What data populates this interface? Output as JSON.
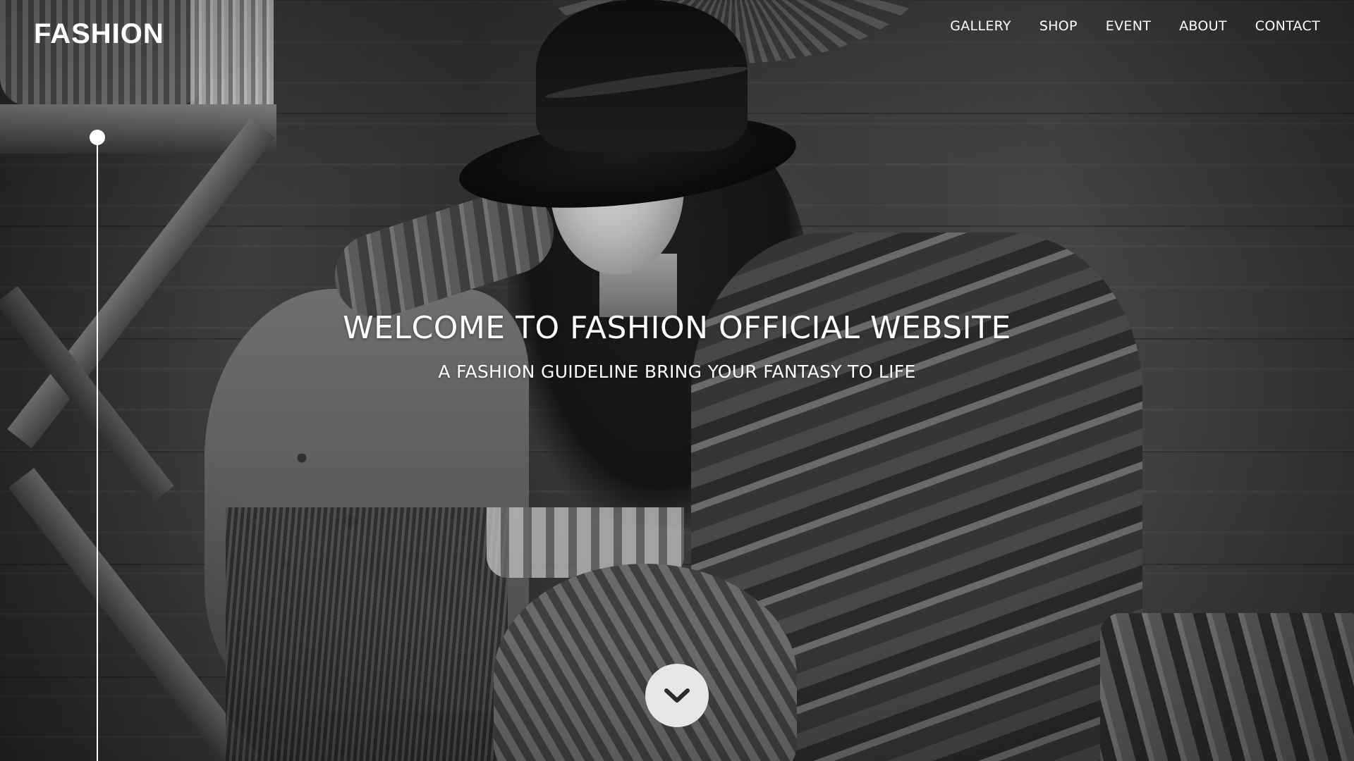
{
  "brand": {
    "logo_text": "FASHION"
  },
  "nav": {
    "items": [
      {
        "label": "GALLERY"
      },
      {
        "label": "SHOP"
      },
      {
        "label": "EVENT"
      },
      {
        "label": "ABOUT"
      },
      {
        "label": "CONTACT"
      }
    ]
  },
  "hero": {
    "title": "WELCOME TO FASHION OFFICIAL WEBSITE",
    "subtitle": "A FASHION GUIDELINE BRING YOUR FANTASY TO LIFE",
    "scroll_icon": "chevron-down-icon"
  },
  "colors": {
    "text": "#ffffff",
    "scroll_button_bg": "#e6e6e6",
    "chevron": "#2a2a2a"
  }
}
